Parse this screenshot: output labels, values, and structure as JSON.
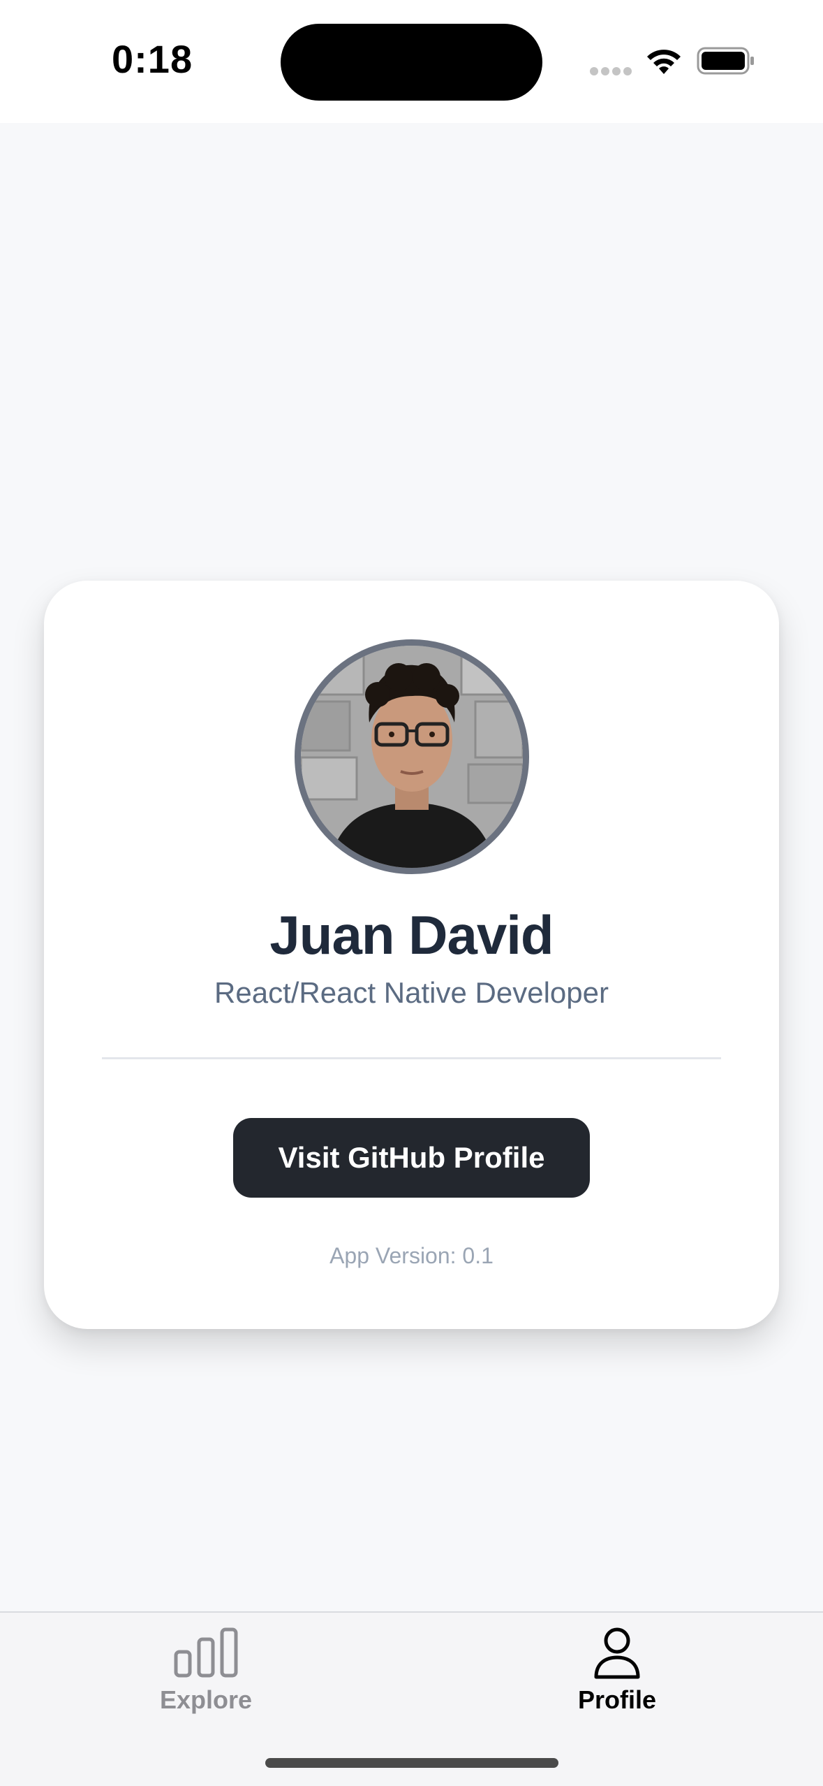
{
  "status_bar": {
    "time": "0:18",
    "icons": [
      "signal-dots-icon",
      "wifi-icon",
      "battery-icon"
    ]
  },
  "profile": {
    "avatar_icon": "profile-photo",
    "name": "Juan David",
    "role": "React/React Native Developer",
    "github_button_label": "Visit GitHub Profile",
    "app_version": "App Version: 0.1"
  },
  "tab_bar": {
    "tabs": [
      {
        "label": "Explore",
        "icon": "bar-chart-icon",
        "active": false
      },
      {
        "label": "Profile",
        "icon": "person-icon",
        "active": true
      }
    ]
  },
  "colors": {
    "background": "#f7f8fa",
    "card": "#ffffff",
    "name_text": "#1f2a3b",
    "role_text": "#5b6b82",
    "button_bg": "#23272e",
    "button_text": "#ffffff",
    "version_text": "#9aa5b4",
    "avatar_border": "#6b7280",
    "tab_inactive": "#8e8e93",
    "tab_active": "#000000"
  }
}
